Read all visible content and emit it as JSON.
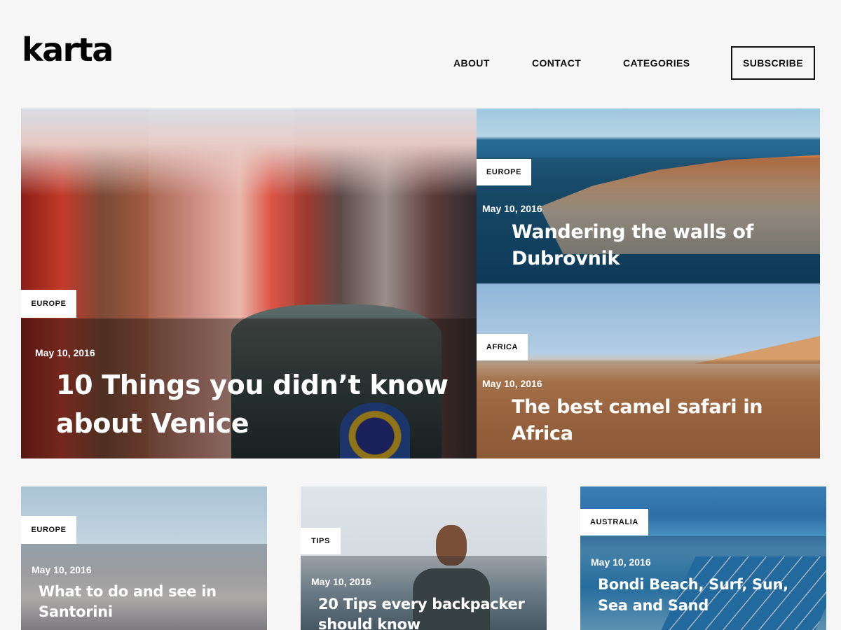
{
  "brand": {
    "logo": "karta"
  },
  "nav": {
    "about": "ABOUT",
    "contact": "CONTACT",
    "categories": "CATEGORIES",
    "subscribe": "SUBSCRIBE"
  },
  "featured": {
    "main": {
      "category": "EUROPE",
      "date": "May 10, 2016",
      "title": "10 Things you didn’t know about Venice"
    },
    "side": [
      {
        "category": "EUROPE",
        "date": "May 10, 2016",
        "title": "Wandering the walls of Dubrovnik"
      },
      {
        "category": "AFRICA",
        "date": "May 10, 2016",
        "title": "The best camel safari in Africa"
      }
    ]
  },
  "posts": [
    {
      "category": "EUROPE",
      "date": "May 10, 2016",
      "title": "What to do and see in Santorini"
    },
    {
      "category": "TIPS",
      "date": "May 10, 2016",
      "title": "20 Tips every backpacker should know"
    },
    {
      "category": "AUSTRALIA",
      "date": "May 10, 2016",
      "title": "Bondi Beach, Surf, Sun, Sea and Sand"
    }
  ],
  "colors": {
    "background": "#f6f6f6",
    "text": "#111111",
    "tag_background": "#ffffff"
  }
}
